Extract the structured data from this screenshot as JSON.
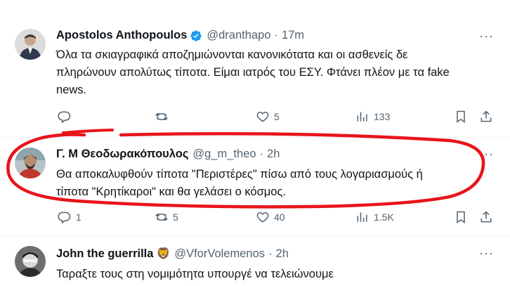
{
  "tweets": [
    {
      "name": "Apostolos Anthopoulos",
      "handle": "@dranthapo",
      "dot": "·",
      "time": "17m",
      "verified": true,
      "text": "Όλα τα σκιαγραφικά αποζημιώνονται κανονικότατα και οι ασθενείς δε\nπληρώνουν απολύτως τίποτα. Είμαι ιατρός του ΕΣΥ. Φτάνει πλέον με τα fake\nnews.",
      "replies": "",
      "retweets": "",
      "likes": "5",
      "views": "133"
    },
    {
      "name": "Γ. Μ Θεοδωρακόπουλος",
      "handle": "@g_m_theo",
      "dot": "·",
      "time": "2h",
      "text": "Θα αποκαλυφθούν τίποτα \"Περιστέρες\" πίσω από τους λογαριασμούς ή\nτίποτα \"Κρητίκαροι\" και θα γελάσει ο κόσμος.",
      "replies": "1",
      "retweets": "5",
      "likes": "40",
      "views": "1.5K"
    },
    {
      "name": "John the guerrilla",
      "emoji": "🦁",
      "handle": "@VforVolemenos",
      "dot": "·",
      "time": "2h",
      "text": "Ταραξτε τους στη νομιμότητα υπουργέ να τελειώνουμε"
    }
  ],
  "icons": {
    "more": "more-icon",
    "reply": "reply-icon",
    "retweet": "retweet-icon",
    "like": "heart-icon",
    "views": "views-icon",
    "bookmark": "bookmark-icon",
    "share": "share-icon"
  },
  "colors": {
    "text": "#0f1419",
    "secondary": "#536471",
    "verified": "#1d9bf0",
    "annotation": "#e8141b"
  }
}
